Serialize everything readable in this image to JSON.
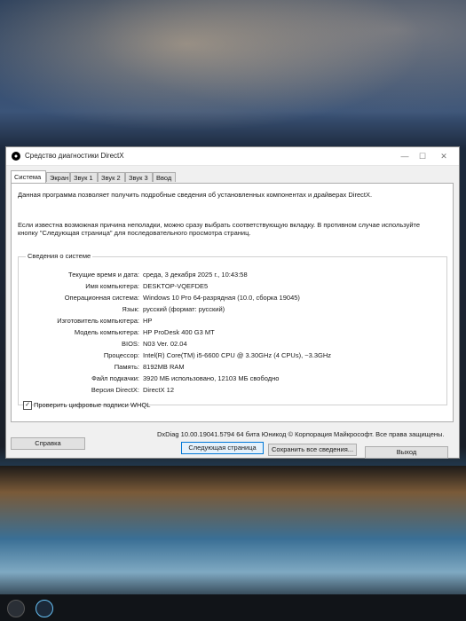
{
  "window": {
    "title": "Средство диагностики DirectX",
    "minimize": "—",
    "maximize": "☐",
    "close": "✕"
  },
  "tabs": [
    "Система",
    "Экран",
    "Звук 1",
    "Звук 2",
    "Звук 3",
    "Ввод"
  ],
  "intro": {
    "line1": "Данная программа позволяет получить подробные сведения об установленных компонентах и драйверах DirectX.",
    "line2": "Если известна возможная причина неполадки, можно сразу выбрать соответствующую вкладку. В противном случае используйте кнопку \"Следующая страница\" для последовательного просмотра страниц."
  },
  "system_info": {
    "group_title": "Сведения о системе",
    "rows": [
      {
        "label": "Текущие время и дата:",
        "value": "среда, 3 декабря 2025 г., 10:43:58"
      },
      {
        "label": "Имя компьютера:",
        "value": "DESKTOP-VQEFDE5"
      },
      {
        "label": "Операционная система:",
        "value": "Windows 10 Pro 64-разрядная (10.0, сборка 19045)"
      },
      {
        "label": "Язык:",
        "value": "русский (формат: русский)"
      },
      {
        "label": "Изготовитель компьютера:",
        "value": "HP"
      },
      {
        "label": "Модель компьютера:",
        "value": "HP ProDesk 400 G3 MT"
      },
      {
        "label": "BIOS:",
        "value": "N03 Ver. 02.04"
      },
      {
        "label": "Процессор:",
        "value": "Intel(R) Core(TM) i5-6600 CPU @ 3.30GHz (4 CPUs), ~3.3GHz"
      },
      {
        "label": "Память:",
        "value": "8192MB RAM"
      },
      {
        "label": "Файл подкачки:",
        "value": "3920 МБ использовано, 12103 МБ свободно"
      },
      {
        "label": "Версия DirectX:",
        "value": "DirectX 12"
      }
    ]
  },
  "checkbox": {
    "label": "Проверить цифровые подписи WHQL",
    "checked": true,
    "mark": "✓"
  },
  "footer": "DxDiag 10.00.19041.5794 64 бита Юникод © Корпорация Майкрософт. Все права защищены.",
  "buttons": {
    "help": "Справка",
    "next": "Следующая страница",
    "save": "Сохранить все сведения...",
    "exit": "Выход"
  },
  "colors": {
    "accent": "#0078d7",
    "window_bg": "#f0f0f0",
    "pane_bg": "#ffffff"
  }
}
